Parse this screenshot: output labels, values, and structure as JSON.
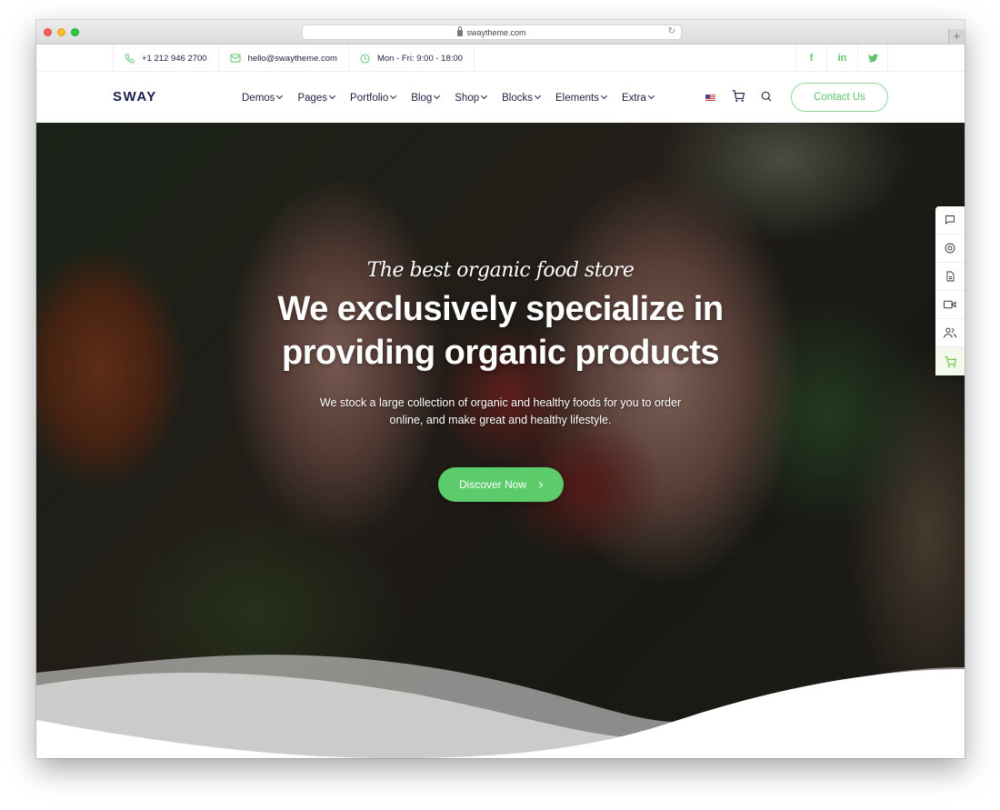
{
  "browser": {
    "url": "swaytheme.com"
  },
  "topbar": {
    "phone": "+1 212 946 2700",
    "email": "hello@swaytheme.com",
    "hours": "Mon - Fri: 9:00 - 18:00",
    "social": [
      {
        "icon": "facebook-icon",
        "glyph": "f"
      },
      {
        "icon": "linkedin-icon",
        "glyph": "in"
      },
      {
        "icon": "twitter-icon",
        "glyph": ""
      }
    ]
  },
  "nav": {
    "logo": "SWAY",
    "items": [
      {
        "label": "Demos"
      },
      {
        "label": "Pages"
      },
      {
        "label": "Portfolio"
      },
      {
        "label": "Blog"
      },
      {
        "label": "Shop"
      },
      {
        "label": "Blocks"
      },
      {
        "label": "Elements"
      },
      {
        "label": "Extra"
      }
    ],
    "contact_label": "Contact Us"
  },
  "hero": {
    "script_title": "The best organic food store",
    "title_line1": "We exclusively specialize in",
    "title_line2": "providing organic products",
    "desc_line1": "We stock a large collection of organic and healthy foods for you to order",
    "desc_line2": "online, and make great and healthy lifestyle.",
    "cta_label": "Discover Now"
  },
  "side_toolbar": {
    "items": [
      "chat-icon",
      "support-icon",
      "document-icon",
      "video-icon",
      "users-icon",
      "cart-icon"
    ]
  },
  "colors": {
    "accent": "#5ccb6a",
    "navy": "#1a1f4f"
  }
}
